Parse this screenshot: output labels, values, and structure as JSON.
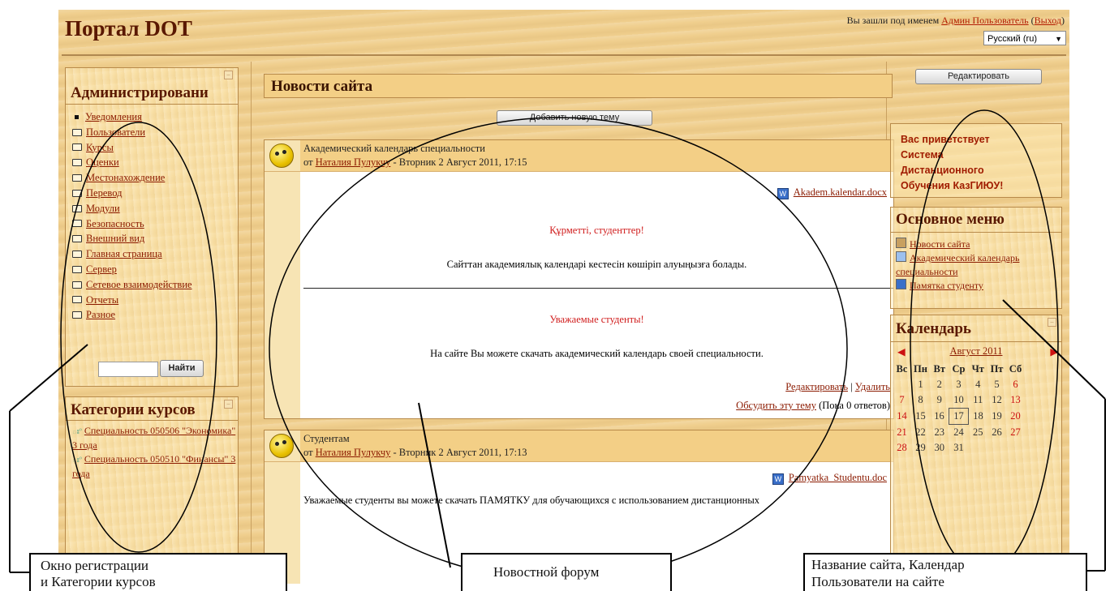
{
  "header": {
    "site_title": "Портал DOT",
    "login_prefix": "Вы зашли под именем",
    "login_user": "Админ Пользователь",
    "logout": "Выход",
    "language": "Русский (ru)"
  },
  "admin_block": {
    "title": "Администрировани",
    "items": [
      "Уведомления",
      "Пользователи",
      "Курсы",
      "Оценки",
      "Местонахождение",
      "Перевод",
      "Модули",
      "Безопасность",
      "Внешний вид",
      "Главная страница",
      "Сервер",
      "Сетевое взаимодействие",
      "Отчеты",
      "Разное"
    ],
    "search_button": "Найти"
  },
  "categories_block": {
    "title": "Категории курсов",
    "items": [
      "Специальность 050506 \"Экономика\" 3 года",
      "Специальность 050510 \"Финансы\" 3 года"
    ]
  },
  "news": {
    "title": "Новости сайта",
    "add_button": "Добавить новую тему",
    "posts": [
      {
        "subject": "Академический календарь специальности",
        "by_prefix": "от",
        "author": "Наталия Пулукчу",
        "date": "- Вторник 2 Август 2011, 17:15",
        "attachment": "Akadem.kalendar.docx",
        "kz_heading": "Құрметті, студенттер!",
        "kz_text": "Сайттан академиялық календарі кестесін көшіріп алуыңызға болады.",
        "ru_heading": "Уважаемые студенты!",
        "ru_text": "На сайте Вы можете скачать академический календарь своей специальности.",
        "edit": "Редактировать",
        "delete": "Удалить",
        "discuss": "Обсудить эту тему",
        "replies": "(Пока 0 ответов)"
      },
      {
        "subject": "Студентам",
        "by_prefix": "от",
        "author": "Наталия Пулукчу",
        "date": "- Вторник 2 Август 2011, 17:13",
        "attachment": "Pamyatka_Studentu.doc",
        "text": "Уважаемые студенты вы можете скачать ПАМЯТКУ для обучающихся с использованием дистанционных"
      }
    ]
  },
  "right": {
    "edit_button": "Редактировать",
    "welcome": [
      "Вас приветствует",
      "Система",
      "Дистанционного",
      "Обучения КазГИЮУ!"
    ],
    "main_menu_title": "Основное меню",
    "main_menu_items": [
      "Новости сайта",
      "Академический календарь специальности",
      "Памятка студенту"
    ],
    "calendar_title": "Календарь",
    "calendar_month": "Август 2011",
    "weekdays": [
      "Вс",
      "Пн",
      "Вт",
      "Ср",
      "Чт",
      "Пт",
      "Сб"
    ],
    "today": "17"
  },
  "annotations": {
    "left": [
      "Окно регистрации",
      "и  Категории курсов"
    ],
    "middle": "Новостной форум",
    "right": [
      "Название  сайта,  Календар",
      "Пользователи на сайте"
    ]
  },
  "colors": {
    "accent_red": "#d01c1c",
    "link": "#8b1a00",
    "block_bg": "#f3cf86",
    "title": "#5a1800"
  }
}
